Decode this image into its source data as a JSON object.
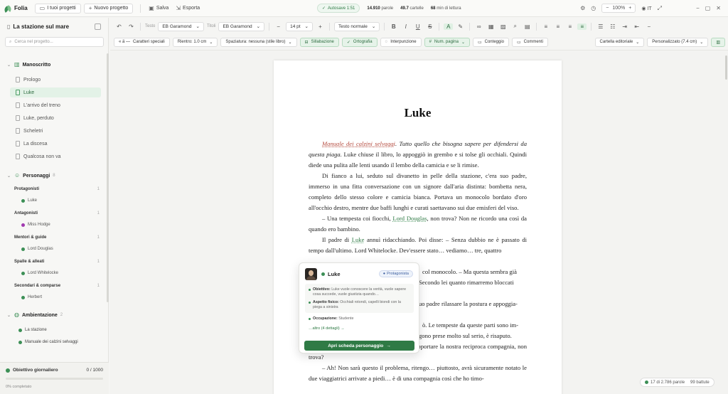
{
  "app": {
    "name": "Folia"
  },
  "titlebar": {
    "my_projects": "I tuoi progetti",
    "new_project": "Nuovo progetto",
    "save": "Salva",
    "export": "Esporta",
    "autosave": "Autosave 1:51",
    "words_value": "14.910",
    "words_label": "parole",
    "pages_value": "49.7",
    "pages_label": "cartelle",
    "reading_value": "68",
    "reading_label": "min di lettura",
    "zoom": "100%",
    "language": "IT"
  },
  "sidebar": {
    "project_title": "La stazione sul mare",
    "search_placeholder": "Cerca nel progetto...",
    "manuscript_label": "Manoscritto",
    "chapters": [
      "Prologo",
      "Luke",
      "L'arrivo del treno",
      "Luke, perduto",
      "Scheletri",
      "La discesa",
      "Qualcosa non va"
    ],
    "active_chapter": "Luke",
    "characters_label": "Personaggi",
    "characters_count": "8",
    "groups": [
      {
        "name": "Protagonisti",
        "count": "1",
        "people": [
          {
            "name": "Luke",
            "color": "#3c8f56"
          }
        ]
      },
      {
        "name": "Antagonisti",
        "count": "1",
        "people": [
          {
            "name": "Miss Hodge",
            "color": "#a13ab0"
          }
        ]
      },
      {
        "name": "Mentori & guide",
        "count": "1",
        "people": [
          {
            "name": "Lord Douglas",
            "color": "#3c8f56"
          }
        ]
      },
      {
        "name": "Spalle & alleati",
        "count": "1",
        "people": [
          {
            "name": "Lord Whitelocke",
            "color": "#3c8f56"
          }
        ]
      },
      {
        "name": "Secondari & comparse",
        "count": "1",
        "people": [
          {
            "name": "Herbert",
            "color": "#3c8f56"
          }
        ]
      }
    ],
    "setting_label": "Ambientazione",
    "setting_count": "2",
    "places": [
      "La stazione",
      "Manuale dei calzini selvaggi"
    ],
    "goal": {
      "label": "Obiettivo giornaliero",
      "value": "0 / 1000",
      "progress": 0,
      "note": "0% completato"
    }
  },
  "format_toolbar": {
    "text_label": "Testo",
    "text_font": "EB Garamond",
    "title_label": "Titoli",
    "title_font": "EB Garamond",
    "size": "14 pt",
    "style": "Testo normale"
  },
  "options_toolbar": {
    "special_chars": "Caratteri speciali",
    "indent": "Rientro: 1.0 cm",
    "spacing": "Spaziatura: nessuna (stile libro)",
    "hyphenation": "Sillabazione",
    "spelling": "Ortografia",
    "punctuation": "Interpunzione",
    "page_numbers": "Num. pagina",
    "word_count": "Conteggio",
    "comments": "Commenti",
    "page_format": "Cartella editoriale",
    "custom": "Personalizzato (7.4 cm)"
  },
  "document": {
    "chapter_title": "Luke",
    "p1_a": "Manuale dei calzini selvaggi",
    "p1_b": ". Tutto quello che bisogna sapere per difendersi da questa piaga.",
    "p1_c": " Luke chiuse il libro, lo appoggiò in grembo e si tolse gli occhiali. Quindi diede una pulita alle lenti usando il lembo della camicia e se li rimise.",
    "p2": "Di fianco a lui, seduto sul divanetto in pelle della stazione, c'era suo padre, immerso in una fitta conversazione con un signore dall'aria distinta: bombetta nera, completo dello stesso colore e camicia bianca. Portava un monocolo bordato d'oro all'occhio destro, mentre due baffi lunghi e curati saettavano sui due emisferi del viso.",
    "p3_a": "– Una tempesta coi fiocchi, ",
    "p3_b": "Lord Douglas",
    "p3_c": ", non trova? Non ne ricordo una così da quando ero bambino.",
    "p4_a": "Il padre di ",
    "p4_b": "Luke",
    "p4_c": " annuì ridacchiando. Poi disse: – Senza dubbio ne è passato di tempo dall'ultimo. Lord Whitelocke. Dev'essere stato… vediamo… tre, quattro",
    "p5": "col monocolo. – Ma questa sembra già",
    "p6": "Secondo lei quanto rimarremo bloccati",
    "p7": "uo padre rilassare la postura e appoggia-",
    "p8": "ò. Le tempeste da queste parti sono im-",
    "p9": "gono prese molto sul serio, è risaputo.",
    "p10": "Finché la furia infuria l'inferno, dovremo sopportare la nostra reciproca compagnia, non trova?",
    "p11": "– Ah! Non sarà questo il problema, ritengo… piuttosto, avrà sicuramente notato le due viaggiatrici arrivate a piedi… è di una compagnia così che ho timo-"
  },
  "character_card": {
    "name": "Luke",
    "role": "Protagonista",
    "objective_label": "Obiettivo:",
    "objective": "Luke vuole conoscere la verità, vuole sapere cosa succede, vuole giustizia quando…",
    "appearance_label": "Aspetto fisico:",
    "appearance": "Occhiali rotondi, capelli biondi con la piega a sinistra",
    "occupation_label": "Occupazione:",
    "occupation": "Studente",
    "more": "…altro (4 dettagli)",
    "open_button": "Apri scheda personaggio"
  },
  "status": {
    "words": "17 di 2.786 parole",
    "chars": "99 battute"
  },
  "colors": {
    "accent": "#3c8f56",
    "accent_dark": "#2f7a45",
    "red_title": "#b3473a",
    "antagonist": "#a13ab0"
  }
}
